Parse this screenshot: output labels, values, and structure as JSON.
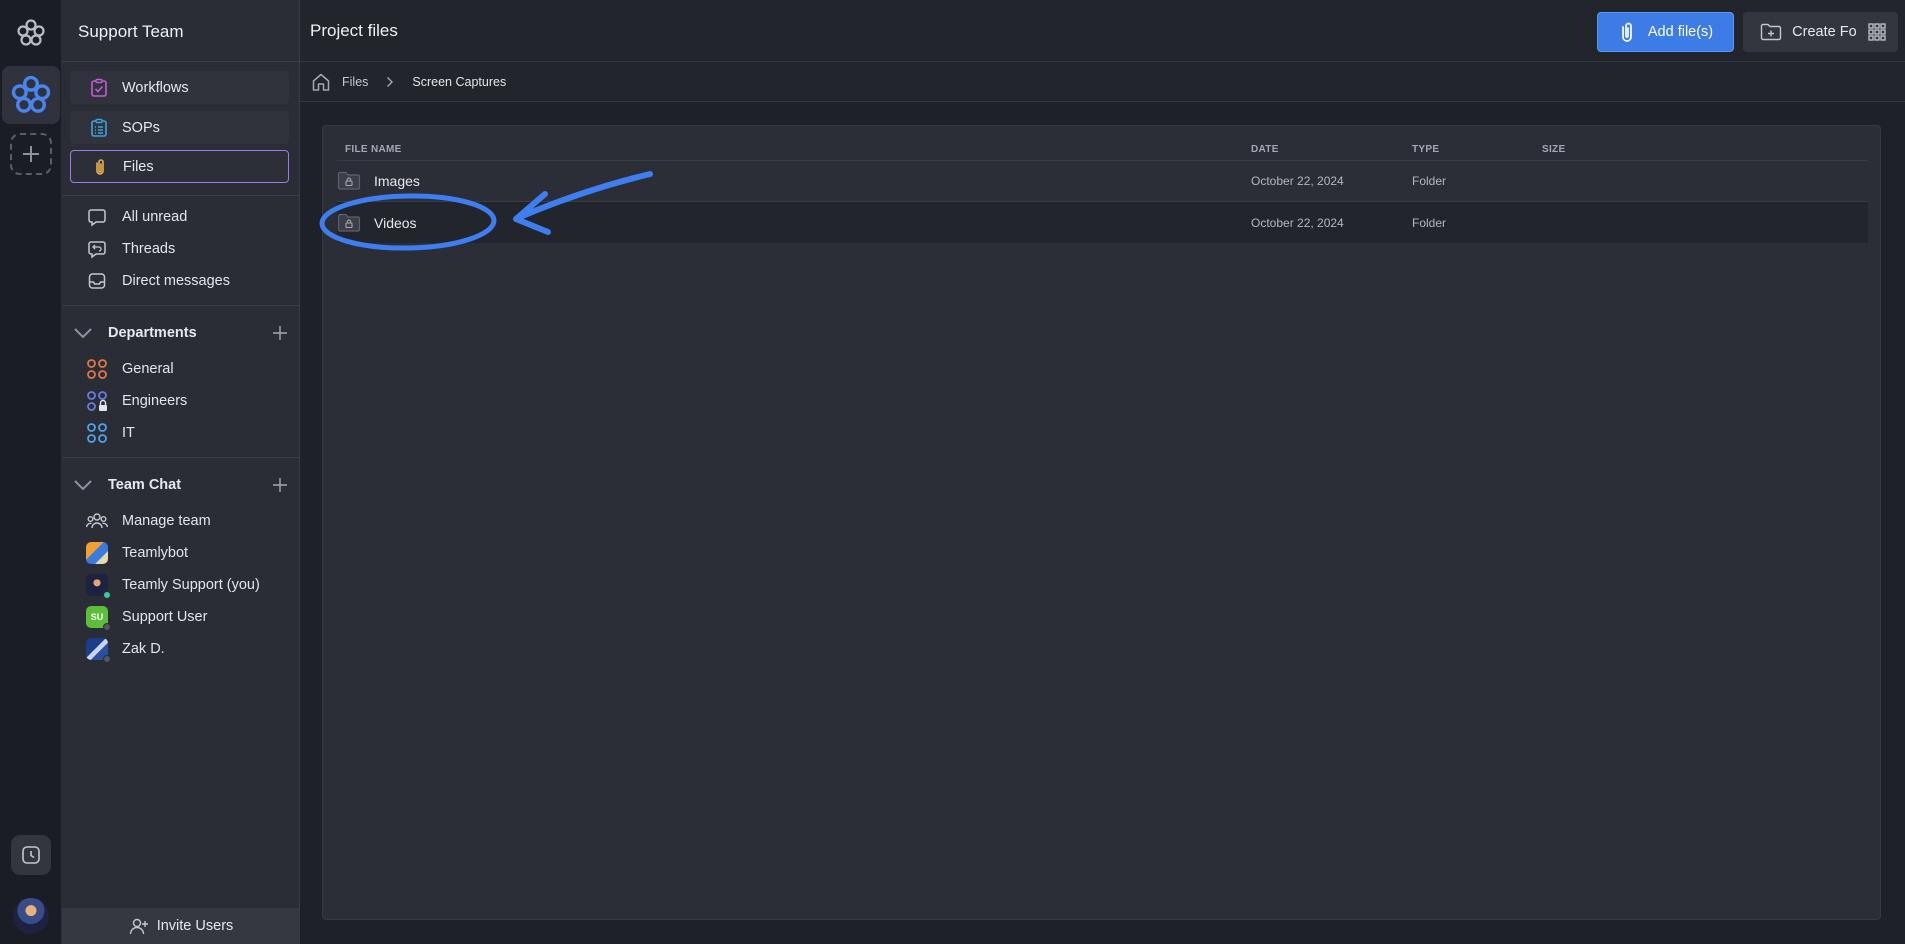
{
  "sidebar": {
    "team_name": "Support Team",
    "nav": [
      {
        "label": "Workflows",
        "icon": "workflows-icon",
        "color": "#c65ad9"
      },
      {
        "label": "SOPs",
        "icon": "sops-icon",
        "color": "#3fa0e0"
      },
      {
        "label": "Files",
        "icon": "paperclip-icon",
        "color": "#e8b04a",
        "active": true
      }
    ],
    "items": [
      {
        "label": "All unread",
        "icon": "chat-bubble-icon"
      },
      {
        "label": "Threads",
        "icon": "threads-icon"
      },
      {
        "label": "Direct messages",
        "icon": "inbox-icon"
      }
    ],
    "departments": {
      "title": "Departments",
      "items": [
        {
          "label": "General",
          "icon": "channel-grid-icon",
          "color": "#e0774a"
        },
        {
          "label": "Engineers",
          "icon": "channel-grid-locked-icon",
          "color": "#6a7be8"
        },
        {
          "label": "IT",
          "icon": "channel-grid-icon",
          "color": "#4fa3e8"
        }
      ]
    },
    "team_chat": {
      "title": "Team Chat",
      "items": [
        {
          "label": "Manage team",
          "icon": "team-icon"
        },
        {
          "label": "Teamlybot",
          "icon": "teamlybot-avatar"
        },
        {
          "label": "Teamly Support (you)",
          "icon": "support-avatar",
          "status": "#3fc8a0"
        },
        {
          "label": "Support User",
          "icon": "su-avatar",
          "initials": "SU",
          "status": "#55585f"
        },
        {
          "label": "Zak D.",
          "icon": "zak-avatar",
          "status": "#55585f"
        }
      ]
    },
    "invite_label": "Invite Users"
  },
  "topbar": {
    "title": "Project files",
    "add_files_label": "Add file(s)",
    "create_folder_label": "Create Folder"
  },
  "breadcrumb": {
    "root": "Files",
    "current": "Screen Captures"
  },
  "table": {
    "columns": [
      "FILE NAME",
      "DATE",
      "TYPE",
      "SIZE"
    ],
    "rows": [
      {
        "name": "Images",
        "date": "October 22, 2024",
        "type": "Folder",
        "size": ""
      },
      {
        "name": "Videos",
        "date": "October 22, 2024",
        "type": "Folder",
        "size": ""
      }
    ]
  },
  "colors": {
    "accent": "#3b7ce6",
    "annotation": "#3f7ef0"
  }
}
